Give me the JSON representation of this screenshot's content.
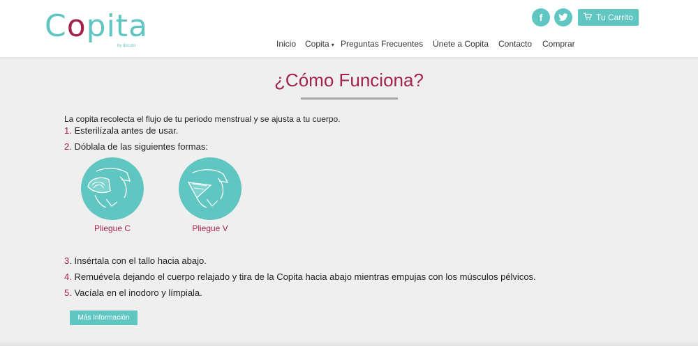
{
  "brand": {
    "logo_text_pre": "C",
    "logo_text_o": "o",
    "logo_text_post": "pita",
    "logo_sub": "by docuro",
    "accent": "#5fc6c1",
    "brand_color": "#a3234f"
  },
  "header": {
    "social": [
      {
        "icon": "facebook-icon",
        "glyph": "f"
      },
      {
        "icon": "twitter-icon",
        "glyph": "t"
      }
    ],
    "cart_label": "Tu Carrito",
    "nav": {
      "inicio": "Inicio",
      "copita": "Copita",
      "faq": "Preguntas Frecuentes",
      "unete": "Únete a Copita",
      "contacto": "Contacto",
      "comprar": "Comprar"
    }
  },
  "main": {
    "title": "¿Cómo Funciona?",
    "intro": "La copita recolecta el flujo de tu periodo menstrual y se ajusta a tu cuerpo.",
    "steps": [
      {
        "num": "1.",
        "text": "Esterilízala antes de usar."
      },
      {
        "num": "2.",
        "text": "Dóblala de las siguientes formas:"
      },
      {
        "num": "3.",
        "text": "Insértala con el tallo hacia abajo."
      },
      {
        "num": "4.",
        "text": "Remuévela dejando el cuerpo relajado y tira de la Copita hacia abajo mientras empujas con los músculos pélvicos."
      },
      {
        "num": "5.",
        "text": "Vacíala en el inodoro y límpiala."
      }
    ],
    "folds": [
      {
        "label": "Pliegue C"
      },
      {
        "label": "Pliegue V"
      }
    ],
    "more_button": "Más Información"
  }
}
